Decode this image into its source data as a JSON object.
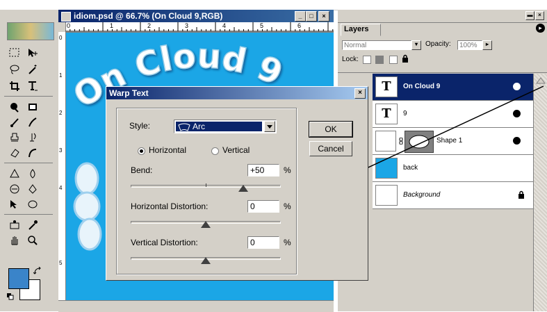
{
  "document": {
    "title": "idiom.psd @ 66.7% (On Cloud 9,RGB)",
    "canvas_text": "On Cloud 9",
    "ruler_numbers": [
      "0",
      "1",
      "2",
      "3",
      "4",
      "5",
      "6"
    ],
    "left_ruler_numbers": [
      "0",
      "1",
      "2",
      "3",
      "4",
      "5"
    ],
    "window_buttons": [
      "_",
      "□",
      "×"
    ]
  },
  "layers_panel": {
    "tab_label": "Layers",
    "blend_mode": "Normal",
    "opacity_label": "Opacity:",
    "opacity_value": "100%",
    "lock_label": "Lock:",
    "panel_buttons": [
      "▬",
      "×",
      "▸"
    ],
    "layers": [
      {
        "name": "On Cloud 9",
        "thumb": "T",
        "selected": true
      },
      {
        "name": "9",
        "thumb": "T",
        "selected": false
      },
      {
        "name": "Shape 1",
        "thumb": "",
        "selected": false
      },
      {
        "name": "back",
        "thumb": "",
        "selected": false
      },
      {
        "name": "Background",
        "thumb": "",
        "selected": false
      }
    ]
  },
  "warp_dialog": {
    "title": "Warp Text",
    "close_label": "×",
    "style_label": "Style:",
    "style_value": "Arc",
    "orientation_horizontal": "Horizontal",
    "orientation_vertical": "Vertical",
    "orientation_selected": "Horizontal",
    "bend_label": "Bend:",
    "bend_value": "+50",
    "bend_position_pct": 75,
    "hdist_label": "Horizontal Distortion:",
    "hdist_value": "0",
    "hdist_position_pct": 50,
    "vdist_label": "Vertical Distortion:",
    "vdist_value": "0",
    "vdist_position_pct": 50,
    "percent_unit": "%",
    "ok_label": "OK",
    "cancel_label": "Cancel"
  },
  "colors": {
    "canvas_blue": "#1ba6e6",
    "titlebar_blue": "#0a246a",
    "foreground_swatch": "#3a84c9",
    "background_swatch": "#ffffff",
    "chrome_gray": "#d4d0c8"
  }
}
